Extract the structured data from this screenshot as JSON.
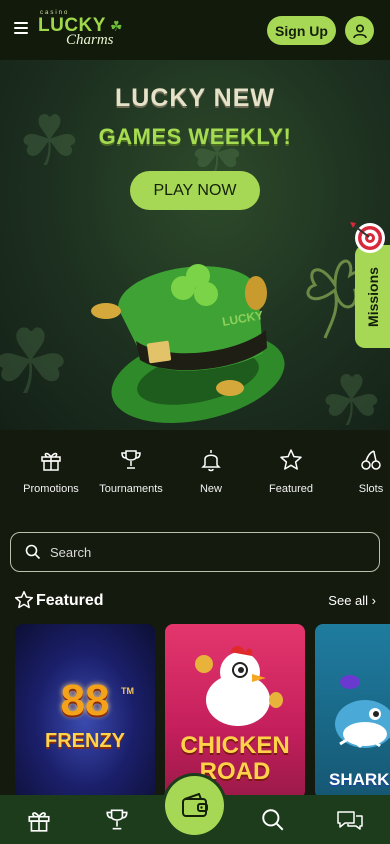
{
  "header": {
    "logo_top": "casino",
    "logo_main": "LUCKY",
    "logo_script": "Charms",
    "signup_label": "Sign Up"
  },
  "hero": {
    "line1": "LUCKY NEW",
    "line2": "GAMES WEEKLY!",
    "cta_label": "PLAY NOW",
    "side_tab_label": "Missions"
  },
  "categories": [
    {
      "label": "Promotions",
      "icon": "gift-icon"
    },
    {
      "label": "Tournaments",
      "icon": "trophy-icon"
    },
    {
      "label": "New",
      "icon": "bell-icon"
    },
    {
      "label": "Featured",
      "icon": "star-icon"
    },
    {
      "label": "Slots",
      "icon": "cherries-icon"
    }
  ],
  "search": {
    "placeholder": "Search"
  },
  "featured": {
    "title": "Featured",
    "see_all": "See all ›",
    "games": [
      {
        "title_top": "88",
        "title_bottom": "FRENZY",
        "tm": "TM"
      },
      {
        "title_top": "CHICKEN",
        "title_bottom": "ROAD"
      },
      {
        "title_top": "SHARK",
        "title_bottom": ""
      }
    ]
  },
  "bottom_nav": {
    "items": [
      "gift-icon",
      "trophy-icon",
      "wallet-icon",
      "search-icon",
      "chat-icon"
    ]
  },
  "colors": {
    "accent": "#a6d755",
    "background": "#141a0d",
    "nav_bg": "#1c3c1c"
  }
}
